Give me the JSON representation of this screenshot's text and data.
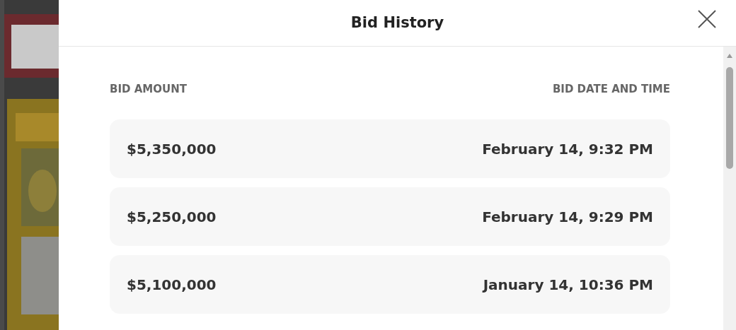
{
  "dialog": {
    "title": "Bid History"
  },
  "table": {
    "columns": [
      "BID AMOUNT",
      "BID DATE AND TIME"
    ],
    "rows": [
      {
        "amount": "$5,350,000",
        "date": "February 14, 9:32 PM"
      },
      {
        "amount": "$5,250,000",
        "date": "February 14, 9:29 PM"
      },
      {
        "amount": "$5,100,000",
        "date": "January 14, 10:36 PM"
      }
    ]
  }
}
